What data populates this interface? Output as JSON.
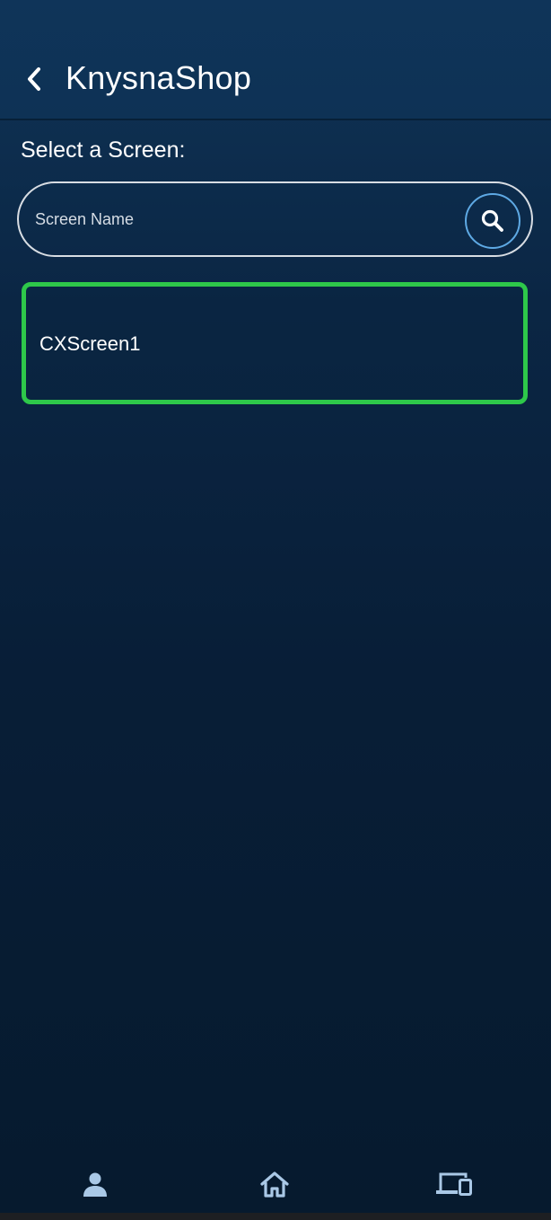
{
  "header": {
    "back_icon": "chevron-left-icon",
    "title": "KnysnaShop"
  },
  "section": {
    "label": "Select a Screen:"
  },
  "search": {
    "placeholder": "Screen Name",
    "value": "",
    "icon": "search-icon"
  },
  "screens": [
    {
      "label": "CXScreen1",
      "selected": true
    }
  ],
  "bottom_nav": {
    "items": [
      {
        "icon": "person-icon"
      },
      {
        "icon": "home-icon"
      },
      {
        "icon": "devices-icon"
      }
    ]
  },
  "colors": {
    "background": "#0b2644",
    "header": "#0f3459",
    "accent_green": "#2ec84a",
    "accent_blue": "#5ea9e4",
    "nav_icon": "#a9c8e6"
  }
}
